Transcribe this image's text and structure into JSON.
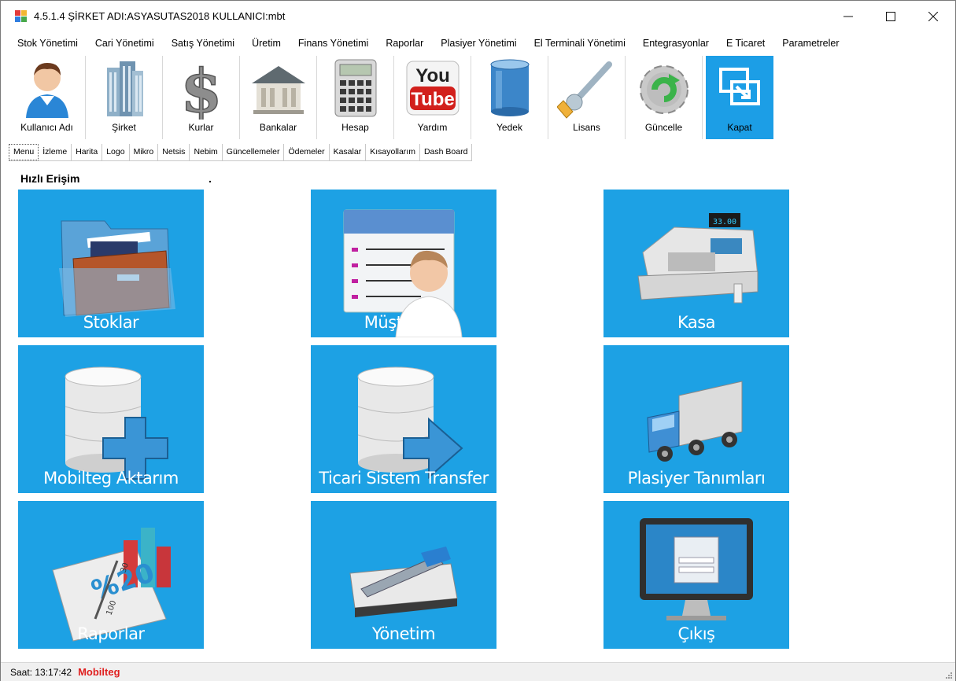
{
  "window": {
    "title": "4.5.1.4 ŞİRKET ADI:ASYASUTAS2018 KULLANICI:mbt",
    "minimize": "—",
    "maximize": "☐",
    "close": "✕"
  },
  "menubar": [
    "Stok Yönetimi",
    "Cari Yönetimi",
    "Satış Yönetimi",
    "Üretim",
    "Finans Yönetimi",
    "Raporlar",
    "Plasiyer Yönetimi",
    "El Terminali Yönetimi",
    "Entegrasyonlar",
    "E Ticaret",
    "Parametreler"
  ],
  "toolbar": [
    {
      "label": "Kullanıcı Adı",
      "icon": "user-icon"
    },
    {
      "label": "Şirket",
      "icon": "building-icon"
    },
    {
      "label": "Kurlar",
      "icon": "dollar-icon"
    },
    {
      "label": "Bankalar",
      "icon": "bank-icon"
    },
    {
      "label": "Hesap",
      "icon": "calculator-icon"
    },
    {
      "label": "Yardım",
      "icon": "youtube-icon",
      "icon_text_top": "You",
      "icon_text_bottom": "Tube"
    },
    {
      "label": "Yedek",
      "icon": "database-icon"
    },
    {
      "label": "Lisans",
      "icon": "key-icon"
    },
    {
      "label": "Güncelle",
      "icon": "refresh-gear-icon"
    },
    {
      "label": "Kapat",
      "icon": "exit-icon"
    }
  ],
  "tabs": [
    "Menu",
    "İzleme",
    "Harita",
    "Logo",
    "Mikro",
    "Netsis",
    "Nebim",
    "Güncellemeler",
    "Ödemeler",
    "Kasalar",
    "Kısayollarım",
    "Dash Board"
  ],
  "quick_access": {
    "title": "Hızlı Erişim",
    "dot": "."
  },
  "tiles": [
    {
      "label": "Stoklar",
      "icon": "folder-icon"
    },
    {
      "label": "Müşteriler",
      "icon": "customer-card-icon"
    },
    {
      "label": "Kasa",
      "icon": "cash-register-icon",
      "display": "33.00"
    },
    {
      "label": "Mobilteg Aktarım",
      "icon": "database-add-icon"
    },
    {
      "label": "Ticari Sistem Transfer",
      "icon": "database-transfer-icon"
    },
    {
      "label": "Plasiyer Tanımları",
      "icon": "truck-icon"
    },
    {
      "label": "Raporlar",
      "icon": "report-chart-icon",
      "tag_1": "%20",
      "tag_2": "30",
      "tag_3": "100"
    },
    {
      "label": "Yönetim",
      "icon": "tools-icon"
    },
    {
      "label": "Çıkış",
      "icon": "monitor-login-icon"
    }
  ],
  "status": {
    "time": "Saat: 13:17:42",
    "brand": "Mobilteg"
  },
  "colors": {
    "tile_blue": "#1da1e4",
    "active_tool": "#1c9ee6",
    "brand_red": "#e02020"
  }
}
